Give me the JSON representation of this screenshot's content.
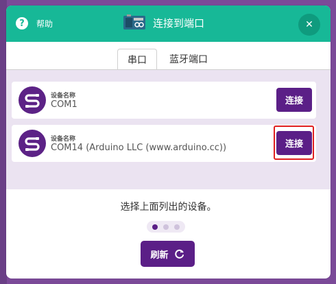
{
  "header": {
    "help_label": "帮助",
    "title": "连接到端口",
    "close_icon": "close-icon"
  },
  "tabs": [
    {
      "label": "串口",
      "active": true
    },
    {
      "label": "蓝牙端口",
      "active": false
    }
  ],
  "devices": [
    {
      "name_label": "设备名称",
      "name": "COM1",
      "connect_label": "连接"
    },
    {
      "name_label": "设备名称",
      "name": "COM14 (Arduino LLC (www.arduino.cc))",
      "connect_label": "连接"
    }
  ],
  "instruction": "选择上面列出的设备。",
  "pagination": {
    "current": 1,
    "total": 3
  },
  "refresh_label": "刷新",
  "colors": {
    "header": "#17b897",
    "accent": "#5b1f87",
    "list_bg": "#ebe3f1",
    "highlight": "#e02020"
  }
}
